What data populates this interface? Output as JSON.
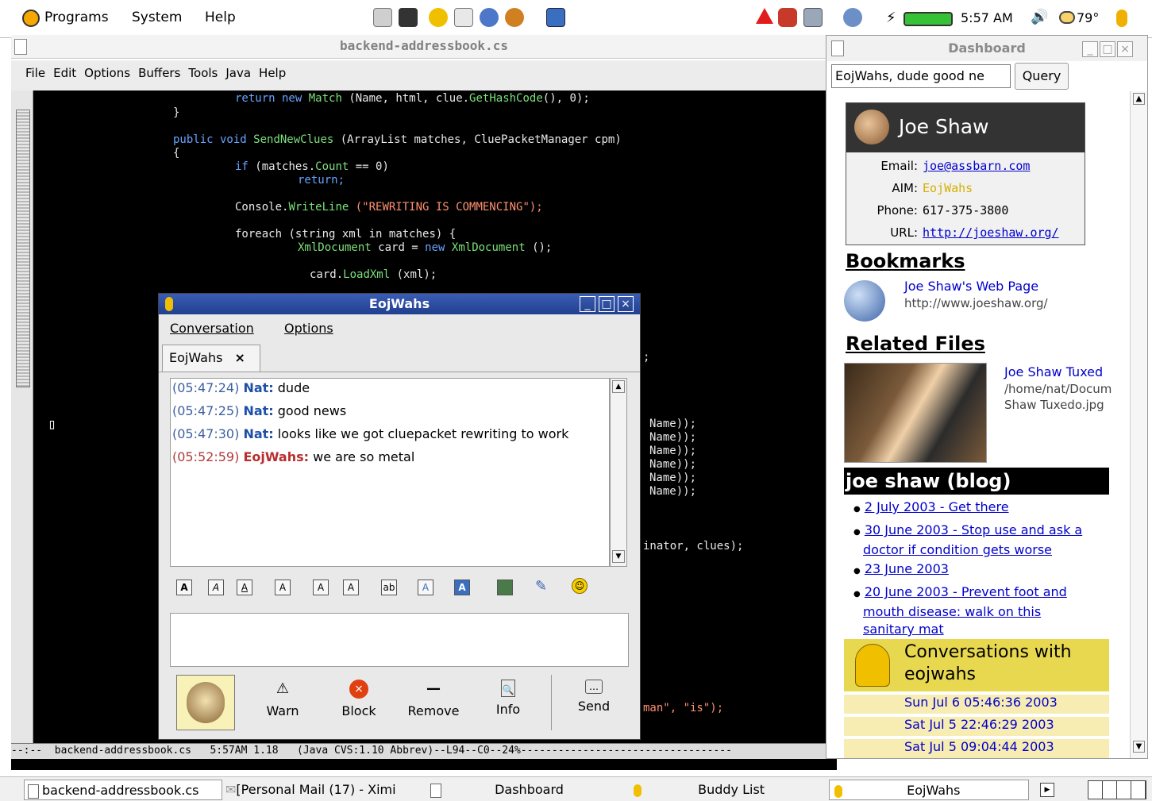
{
  "top_panel": {
    "menus": [
      "Programs",
      "System",
      "Help"
    ],
    "clock": "5:57 AM",
    "temperature": "79°"
  },
  "emacs": {
    "title": "backend-addressbook.cs",
    "menus": [
      "File",
      "Edit",
      "Options",
      "Buffers",
      "Tools",
      "Java",
      "Help"
    ],
    "modeline": "--:--  backend-addressbook.cs   5:57AM 1.18   (Java CVS:1.10 Abbrev)--L94--C0--24%----------------------------------",
    "code": {
      "l1_kw": "return new",
      "l1_ty": "Match",
      "l1_rest": "(Name, html, clue.",
      "l1_fn": "GetHashCode",
      "l1_end": "(), 0);",
      "l2": "}",
      "l3_kw": "public void",
      "l3_fn": "SendNewClues",
      "l3_rest": "(ArrayList matches, ClueP﻿acketManager cpm)",
      "l4": "{",
      "l5_kw": "if",
      "l5_rest": "(matches.",
      "l5_fn": "Count",
      "l5_end": "== 0)",
      "l6_kw": "return;",
      "l7_a": "Console.",
      "l7_fn": "WriteLine",
      "l7_str": "(\"REWRITING IS COMMENCING\");",
      "l8_kw": "foreach",
      "l8_rest": "(string xml in matches) {",
      "l9_ty": "XmlDocument",
      "l9_a": "card =",
      "l9_kw": "new",
      "l9_ty2": "XmlDocument",
      "l9_end": "();",
      "l10_a": "card.",
      "l10_fn": "LoadXml",
      "l10_end": "(xml);",
      "frag_semicolon": ";",
      "frag_name": "Name));",
      "frag_inator": "inator, clues);",
      "frag_man": "man\", \"is\");",
      "cursor_char": "▯"
    }
  },
  "dashboard": {
    "title": "Dashboard",
    "query_value": "EojWahs, dude good ne",
    "query_button": "Query",
    "contact": {
      "name": "Joe Shaw",
      "email_label": "Email:",
      "email": "joe@assbarn.com",
      "aim_label": "AIM:",
      "aim": "EojWahs",
      "phone_label": "Phone:",
      "phone": "617-375-3800",
      "url_label": "URL:",
      "url": "http://joeshaw.org/"
    },
    "bookmarks": {
      "heading": "Bookmarks",
      "title": "Joe Shaw's Web Page",
      "url": "http://www.joeshaw.org/"
    },
    "related": {
      "heading": "Related Files",
      "title": "Joe Shaw Tuxed",
      "path": "/home/nat/Docum",
      "file": "Shaw Tuxedo.jpg"
    },
    "blog": {
      "heading": "joe shaw (blog)",
      "entries": [
        [
          "2 July 2003 - Get there"
        ],
        [
          "30 June 2003 - Stop use and ask a",
          "doctor if condition gets worse"
        ],
        [
          "23 June 2003"
        ],
        [
          "20 June 2003 - Prevent foot and",
          "mouth disease: walk on this",
          "sanitary mat"
        ]
      ]
    },
    "conversations": {
      "heading_l1": "Conversations with",
      "heading_l2": "eojwahs",
      "items": [
        "Sun Jul 6 05:46:36 2003",
        "Sat Jul 5 22:46:29 2003",
        "Sat Jul 5 09:04:44 2003"
      ]
    }
  },
  "chat": {
    "title": "EojWahs",
    "menus": [
      "Conversation",
      "Options"
    ],
    "tab_label": "EojWahs",
    "messages": [
      {
        "time": "(05:47:24)",
        "who": "Nat:",
        "text": "dude"
      },
      {
        "time": "(05:47:25)",
        "who": "Nat:",
        "text": "good news"
      },
      {
        "time": "(05:47:30)",
        "who": "Nat:",
        "text": "looks like we got cluepacket rewriting to work"
      },
      {
        "time": "(05:52:59)",
        "who": "EojWahs:",
        "text": "we are so metal"
      }
    ],
    "actions": [
      "Warn",
      "Block",
      "Remove",
      "Info",
      "Send"
    ]
  },
  "taskbar": {
    "items": [
      "backend-addressbook.cs",
      "[Personal Mail (17) - Ximi",
      "Dashboard",
      "Buddy List",
      "EojWahs"
    ]
  },
  "colors": {
    "chat_titlebar": "#2b4aa0",
    "nat_name": "#1d4fa8",
    "self_name": "#b82e2e",
    "link": "#0000cc",
    "editor_bg": "#000000"
  },
  "icons": [
    "foot-icon",
    "gear-icon",
    "warning-icon",
    "battery-icon",
    "volume-icon",
    "weather-icon",
    "globe-icon",
    "buddy-icon"
  ]
}
